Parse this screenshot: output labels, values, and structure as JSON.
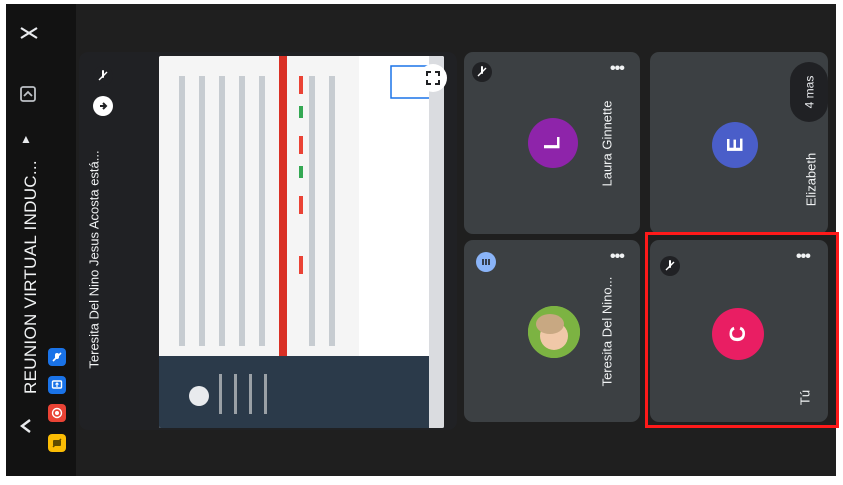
{
  "meeting": {
    "title": "REUNION VIRTUAL INDUC...",
    "presenter_label": "Teresita Del Nino Jesus Acosta está..."
  },
  "participants": [
    {
      "name": "Laura Ginnette",
      "initial": "L",
      "color": "#9c27b0"
    },
    {
      "name": "Elizabeth",
      "initial": "E",
      "color": "#4a5ec9"
    },
    {
      "name": "Teresita Del Nino...",
      "initial": "",
      "color": "#8bc34a"
    },
    {
      "name": "Tú",
      "initial": "C",
      "color": "#e91e63"
    }
  ],
  "more_label": "4 mas",
  "menu_dots": "•••",
  "icons": {
    "top_strip": "layout-icon",
    "chat": "chat-icon",
    "back": "chevron-left-icon",
    "expand_title": "chevron-up-icon",
    "muted": "mic-off-icon",
    "pin": "pin-icon",
    "fullscreen": "fullscreen-icon",
    "hand": "hand-icon",
    "presenting": "presenting-icon"
  },
  "colors": {
    "background": "#1f1f1f",
    "tile": "#3c4043",
    "highlight": "#ff1a1a"
  }
}
